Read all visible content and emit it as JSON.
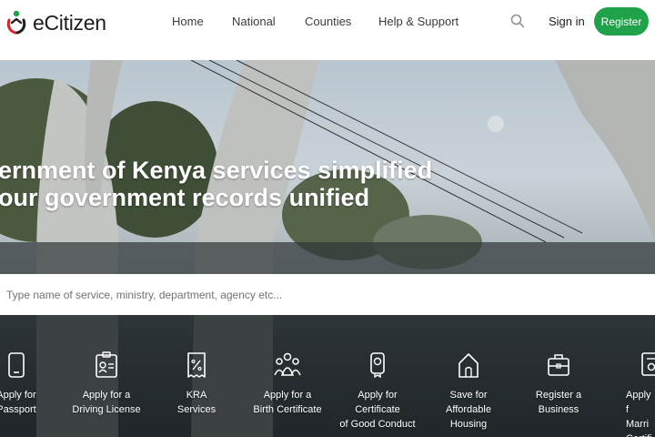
{
  "brand": {
    "name": "eCitizen"
  },
  "nav": {
    "home": "Home",
    "national": "National",
    "counties": "Counties",
    "help": "Help & Support",
    "sign_in": "Sign in",
    "register": "Register"
  },
  "hero": {
    "line1": "ernment of Kenya services simplified",
    "line2": "our government records unified",
    "search_placeholder": "Type name of service, ministry, department, agency etc..."
  },
  "services": [
    {
      "label": "Apply for\nPassport",
      "icon": "phone-icon"
    },
    {
      "label": "Apply for a\nDriving License",
      "icon": "id-card-icon"
    },
    {
      "label": "KRA\nServices",
      "icon": "receipt-icon"
    },
    {
      "label": "Apply for a\nBirth Certificate",
      "icon": "family-icon"
    },
    {
      "label": "Apply for\nCertificate\nof Good Conduct",
      "icon": "badge-icon"
    },
    {
      "label": "Save for\nAffordable\nHousing",
      "icon": "house-icon"
    },
    {
      "label": "Register a\nBusiness",
      "icon": "briefcase-icon"
    },
    {
      "label": "Apply f\nMarri\nCertifi",
      "icon": "certificate-icon"
    }
  ],
  "colors": {
    "brand_green": "#1fa24a",
    "logo_red": "#d9262c",
    "text": "#1d1d1d"
  }
}
